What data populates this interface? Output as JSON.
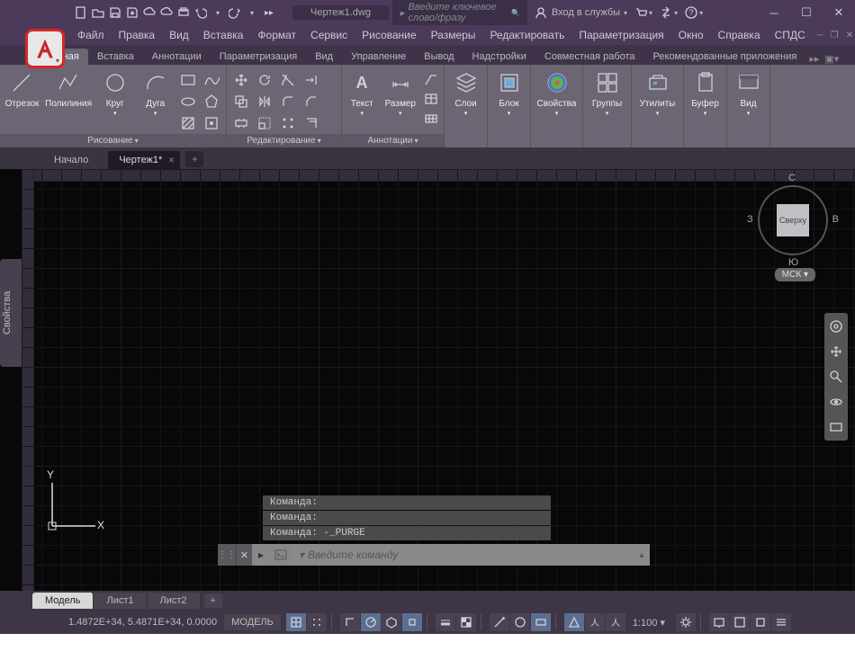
{
  "title": {
    "doc": "Чертеж1.dwg"
  },
  "search": {
    "placeholder": "Введите ключевое слово/фразу"
  },
  "login": {
    "label": "Вход в службы"
  },
  "menubar": [
    "Файл",
    "Правка",
    "Вид",
    "Вставка",
    "Формат",
    "Сервис",
    "Рисование",
    "Размеры",
    "Редактировать",
    "Параметризация",
    "Окно",
    "Справка",
    "СПДС"
  ],
  "ribbon_tabs": [
    "Главная",
    "Вставка",
    "Аннотации",
    "Параметризация",
    "Вид",
    "Управление",
    "Вывод",
    "Надстройки",
    "Совместная работа",
    "Рекомендованные приложения"
  ],
  "ribbon": {
    "draw": {
      "line": "Отрезок",
      "polyline": "Полилиния",
      "circle": "Круг",
      "arc": "Дуга",
      "title": "Рисование"
    },
    "modify": {
      "title": "Редактирование"
    },
    "annot": {
      "text": "Текст",
      "dim": "Размер",
      "title": "Аннотации"
    },
    "layers": {
      "btn": "Слои"
    },
    "block": {
      "btn": "Блок"
    },
    "props": {
      "btn": "Свойства"
    },
    "groups": {
      "btn": "Группы"
    },
    "utils": {
      "btn": "Утилиты"
    },
    "clip": {
      "btn": "Буфер"
    },
    "view": {
      "btn": "Вид"
    }
  },
  "file_tabs": {
    "start": "Начало",
    "active": "Чертеж1*"
  },
  "side_panel": {
    "props": "Свойства"
  },
  "viewcube": {
    "top": "Сверху",
    "n": "С",
    "s": "Ю",
    "e": "В",
    "w": "З"
  },
  "coord_sys": "МСК",
  "ucs": {
    "y": "Y",
    "x": "X"
  },
  "cmd_history": [
    "Команда:",
    "Команда:",
    "Команда: -_PURGE"
  ],
  "cmd_input": {
    "placeholder": "Введите команду"
  },
  "layout_tabs": [
    "Модель",
    "Лист1",
    "Лист2"
  ],
  "status": {
    "coords": "1.4872E+34, 5.4871E+34, 0.0000",
    "mode": "МОДЕЛЬ",
    "scale": "1:100"
  }
}
